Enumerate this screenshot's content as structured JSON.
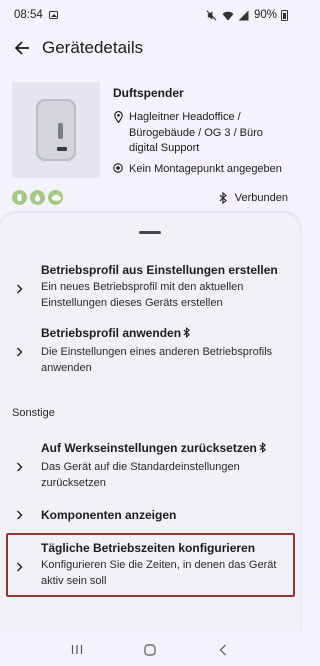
{
  "status_bar": {
    "time": "08:54",
    "battery": "90%",
    "icons": [
      "image-icon",
      "mute-icon",
      "wifi-icon",
      "signal-icon",
      "battery-icon"
    ]
  },
  "app_bar": {
    "title": "Gerätedetails",
    "back_icon": "arrow-back-icon"
  },
  "device": {
    "name": "Duftspender",
    "location": "Hagleitner Headoffice / Bürogebäude / OG 3 / Büro digital Support",
    "mounting": "Kein Montagepunkt angegeben",
    "connection_status": "Verbunden",
    "feature_icons": [
      "feature-icon-1",
      "feature-icon-2",
      "feature-icon-3"
    ],
    "feature_color": "#a6c785"
  },
  "sheet": {
    "items": [
      {
        "title": "Betriebsprofil aus Einstellungen erstellen",
        "description": "Ein neues Betriebsprofil mit den aktuellen Einstellungen dieses Geräts erstellen",
        "bluetooth": false
      },
      {
        "title": "Betriebsprofil anwenden",
        "description": "Die Einstellungen eines anderen Betriebsprofils anwenden",
        "bluetooth": true
      }
    ],
    "section_label": "Sonstige",
    "other_items": [
      {
        "title": "Auf Werkseinstellungen zurücksetzen",
        "description": "Das Gerät auf die Standardeinstellungen zurücksetzen",
        "bluetooth": true
      },
      {
        "title": "Komponenten anzeigen",
        "description": "",
        "bluetooth": false
      },
      {
        "title": "Tägliche Betriebszeiten konfigurieren",
        "description": "Konfigurieren Sie die Zeiten, in denen das Gerät aktiv sein soll",
        "bluetooth": false,
        "highlighted": true
      }
    ],
    "highlight_color": "#8b3a3a"
  },
  "nav_bar": {
    "buttons": [
      "recent-apps-icon",
      "home-icon",
      "back-nav-icon"
    ]
  }
}
